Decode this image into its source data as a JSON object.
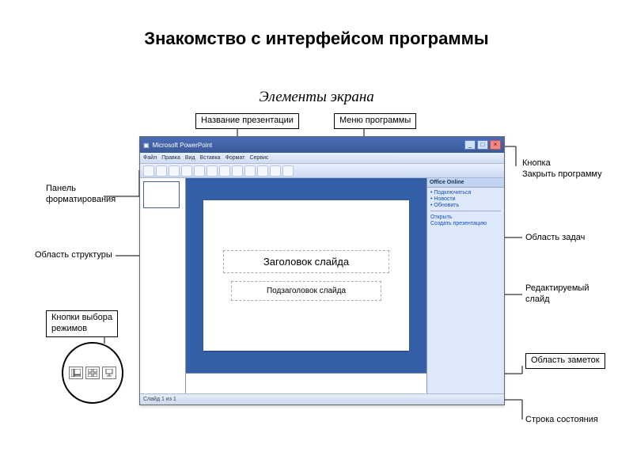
{
  "page_title": "Знакомство с интерфейсом программы",
  "subtitle": "Элементы экрана",
  "slide": {
    "title_placeholder": "Заголовок слайда",
    "subtitle_placeholder": "Подзаголовок слайда"
  },
  "taskpane": {
    "header": "Office Online"
  },
  "labels": {
    "title_label": "Название презентации",
    "menu_label": "Меню программы",
    "close_label": "Кнопка\nЗакрыть программу",
    "format_panel": "Панель\nформатирования",
    "outline_area": "Область  структуры",
    "view_buttons": "Кнопки выбора\nрежимов",
    "taskpane_area": "Область задач",
    "editable_slide": "Редактируемый\nслайд",
    "notes_area": "Область заметок",
    "status_bar": "Строка состояния"
  }
}
